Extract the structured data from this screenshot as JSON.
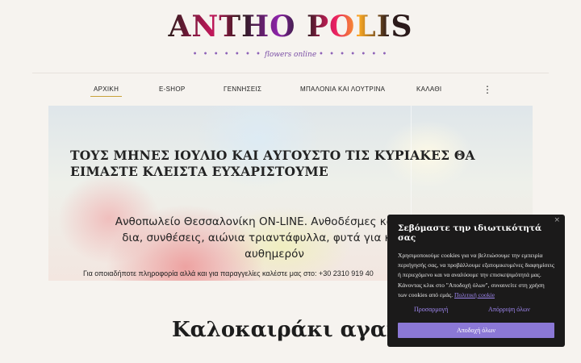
{
  "logo": {
    "text": "ANTHO POLIS",
    "subtitle": "flowers online",
    "dots_left": "• • • • • • •",
    "dots_right": "• • • • • • •"
  },
  "nav": {
    "items": [
      {
        "label": "ΑΡΧΙΚΗ",
        "active": true
      },
      {
        "label": "E-SHOP",
        "active": false
      },
      {
        "label": "ΓΕΝΝΗΣΕΙΣ",
        "active": false
      },
      {
        "label": "ΜΠΑΛΟΝΙΑ ΚΑΙ ΛΟΥΤΡΙΝΑ",
        "active": false
      },
      {
        "label": "ΚΑΛΑΘΙ",
        "active": false
      }
    ],
    "more_icon": "⋮"
  },
  "hero": {
    "title": "ΤΟΥΣ ΜΗΝΕΣ ΙΟΥΛΙΟ ΚΑΙ ΑΥΓΟΥΣΤΟ ΤΙΣ ΚΥΡΙΑΚΕΣ ΘΑ ΕΙΜΑΣΤΕ ΚΛΕΙΣΤΑ ΕΥΧΑΡΙΣΤΟΥΜΕ",
    "description_line1": "Ανθοπωλείο Θεσσαλονίκη ON-LINE. Ανθοδέσμες και μπουκ",
    "description_line2": "δια, συνθέσεις, αιώνια τριαντάφυλλα, φυτά για κάθε πε",
    "description_line3": "αυθημερόν",
    "contact": "Για οποιαδήποτε πληροφορία αλλά και για παραγγελίες καλέστε μας στο: +30 2310 919 40"
  },
  "section": {
    "title": "Καλοκαιράκι αγαπημέν"
  },
  "cookie": {
    "close_icon": "×",
    "title": "Σεβόμαστε την ιδιωτικότητά σας",
    "text": "Χρησιμοποιούμε cookies για να βελτιώσουμε την εμπειρία περιήγησής σας, να προβάλλουμε εξατομικευμένες διαφημίσεις ή περιεχόμενο και να αναλύουμε την επισκεψιμότητά μας. Κάνοντας κλικ στο \"Αποδοχή όλων\", συναινείτε στη χρήση των cookies από εμάς.",
    "policy_link": "Πολιτική cookie",
    "customize": "Προσαρμογή",
    "reject": "Απόρριψη όλων",
    "accept": "Αποδοχή όλων",
    "accent_color": "#8b78d6"
  }
}
